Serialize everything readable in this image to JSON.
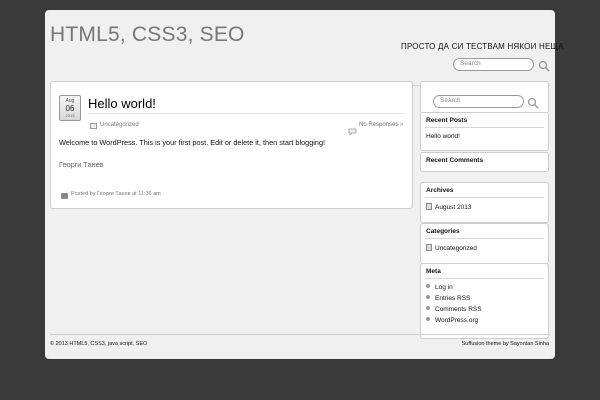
{
  "header": {
    "site_title": "HTML5, CSS3, SEO",
    "site_description": "ПРОСТО ДА СИ ТЕСТВАМ НЯКОИ НЕЩА",
    "search_placeholder": "Search"
  },
  "post": {
    "date_month": "Aug",
    "date_day": "06",
    "date_year": "2013",
    "title": "Hello world!",
    "category": "Uncategorized",
    "comments": "No Responses »",
    "body": "Welcome to WordPress. This is your first post. Edit or delete it, then start blogging!",
    "author": "Георги Танев",
    "posted_by": "Posted by Георги Танев at 11:36 am"
  },
  "sidebar": {
    "search_placeholder": "Search",
    "recent_posts": {
      "title": "Recent Posts",
      "items": [
        "Hello world!"
      ]
    },
    "recent_comments": {
      "title": "Recent Comments"
    },
    "archives": {
      "title": "Archives",
      "items": [
        "August 2013"
      ]
    },
    "categories": {
      "title": "Categories",
      "items": [
        "Uncategorized"
      ]
    },
    "meta": {
      "title": "Meta",
      "items": [
        "Log in",
        "Entries RSS",
        "Comments RSS",
        "WordPress.org"
      ]
    }
  },
  "footer": {
    "copyright": "© 2013 HTML5, CSS3, java script, SEO",
    "credit": "Suffusion theme by Sayontan Sinha"
  },
  "icons": {
    "search": "search-icon",
    "category": "folder-icon",
    "comments": "comment-icon",
    "print": "printer-icon",
    "archive": "calendar-icon"
  }
}
